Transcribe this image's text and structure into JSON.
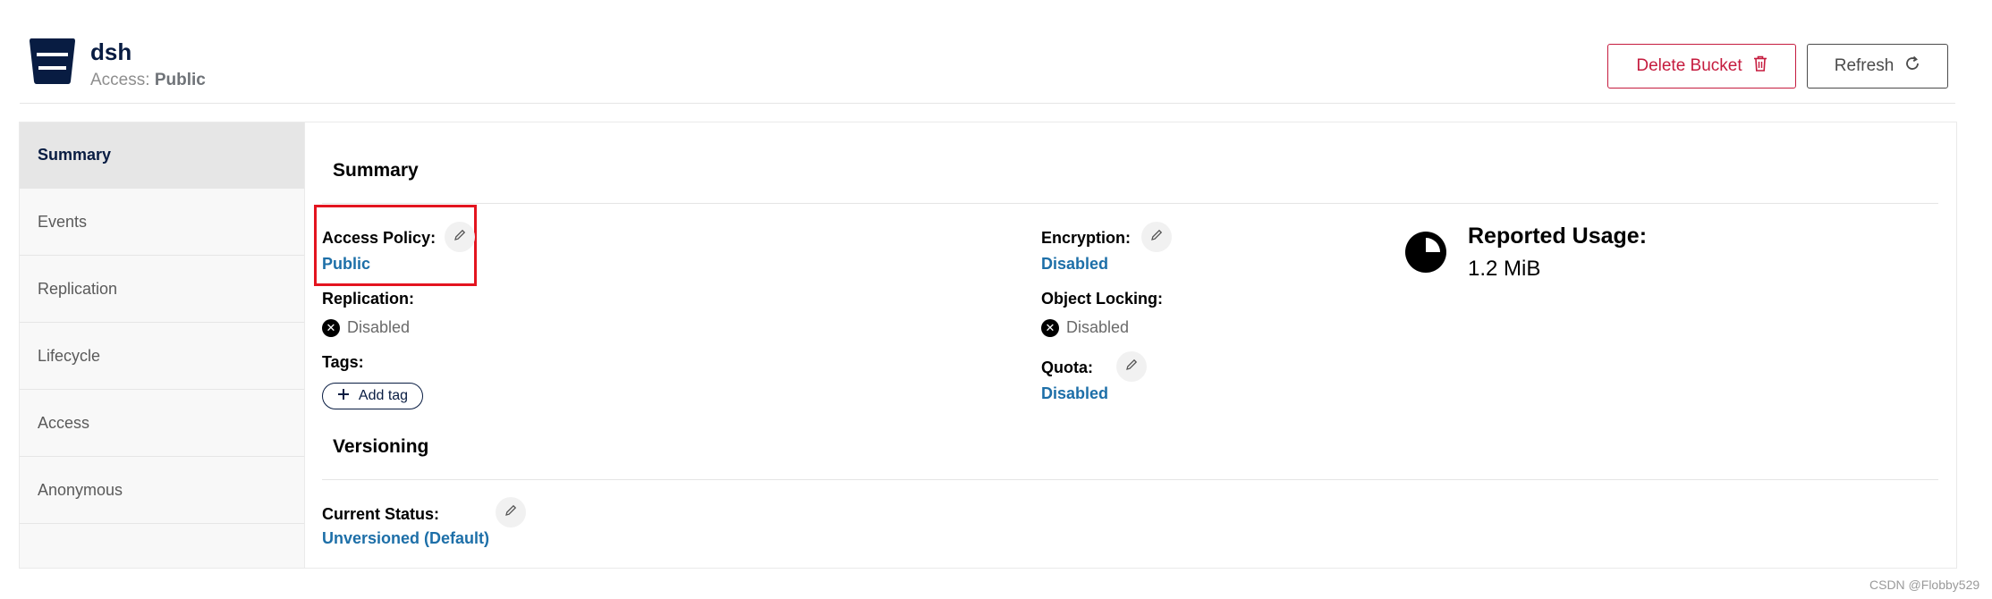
{
  "header": {
    "bucket_name": "dsh",
    "access_label": "Access:",
    "access_value": "Public",
    "delete_button": "Delete Bucket",
    "refresh_button": "Refresh"
  },
  "sidebar": {
    "items": [
      {
        "label": "Summary",
        "active": true
      },
      {
        "label": "Events"
      },
      {
        "label": "Replication"
      },
      {
        "label": "Lifecycle"
      },
      {
        "label": "Access"
      },
      {
        "label": "Anonymous"
      }
    ]
  },
  "summary": {
    "title": "Summary",
    "access_policy": {
      "label": "Access Policy:",
      "value": "Public"
    },
    "replication": {
      "label": "Replication:",
      "value": "Disabled"
    },
    "tags": {
      "label": "Tags:",
      "add_button": "Add tag"
    },
    "encryption": {
      "label": "Encryption:",
      "value": "Disabled"
    },
    "object_locking": {
      "label": "Object Locking:",
      "value": "Disabled"
    },
    "quota": {
      "label": "Quota:",
      "value": "Disabled"
    },
    "usage": {
      "title": "Reported Usage:",
      "value": "1.2 MiB"
    }
  },
  "versioning": {
    "title": "Versioning",
    "current_status": {
      "label": "Current Status:",
      "value": "Unversioned (Default)"
    }
  },
  "watermark": "CSDN @Flobby529",
  "colors": {
    "brand_navy": "#081c42",
    "danger": "#c51b3e",
    "link": "#1d6fa8",
    "highlight": "#e3141f"
  },
  "icons": {
    "bucket": "bucket-icon",
    "delete": "trash-icon",
    "refresh": "refresh-icon",
    "edit": "pencil-icon",
    "disabled": "x-circle-icon",
    "add": "plus-icon",
    "usage": "pie-chart-icon"
  }
}
